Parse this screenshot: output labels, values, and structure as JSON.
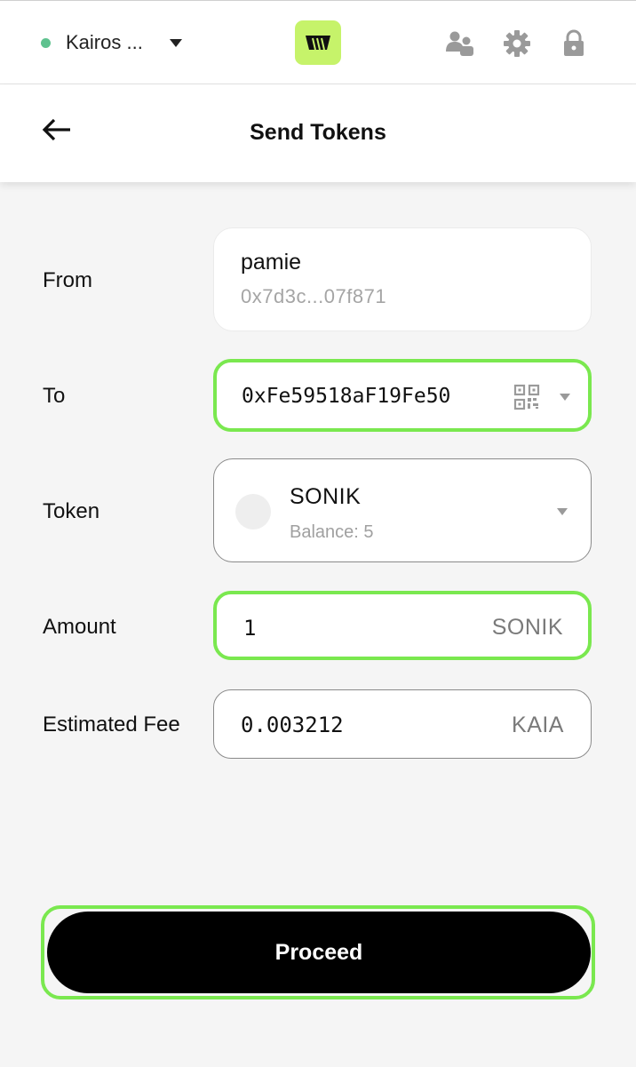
{
  "topbar": {
    "network_name": "Kairos ...",
    "network_status_color": "#5fc28f",
    "logo_color": "#c6f36a",
    "icons": [
      "accounts-icon",
      "gear-icon",
      "lock-icon"
    ]
  },
  "header": {
    "title": "Send Tokens",
    "back_icon": "arrow-left-icon"
  },
  "form": {
    "from": {
      "label": "From",
      "account_name": "pamie",
      "address": "0x7d3c...07f871"
    },
    "to": {
      "label": "To",
      "value": "0xFe59518aF19Fe50",
      "icons": [
        "qr-code-icon",
        "caret-down-icon"
      ]
    },
    "token": {
      "label": "Token",
      "symbol": "SONIK",
      "balance_label": "Balance:",
      "balance_value": "5"
    },
    "amount": {
      "label": "Amount",
      "value": "1",
      "unit": "SONIK"
    },
    "fee": {
      "label": "Estimated Fee",
      "value": "0.003212",
      "unit": "KAIA"
    }
  },
  "actions": {
    "proceed_label": "Proceed"
  },
  "colors": {
    "accent_highlight": "#7ae84f",
    "button_bg": "#000000"
  }
}
